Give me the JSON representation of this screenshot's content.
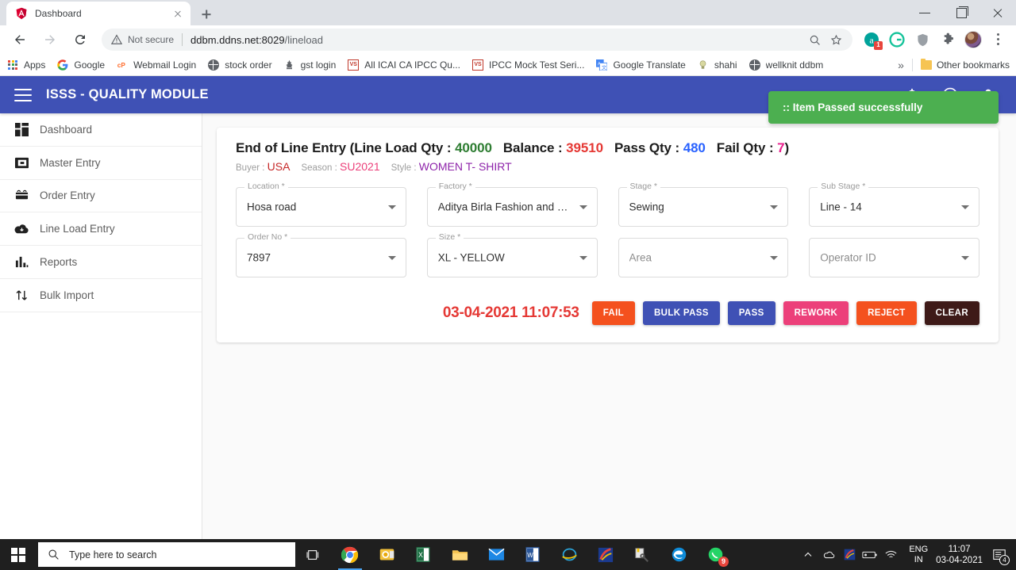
{
  "browser": {
    "tab": {
      "title": "Dashboard",
      "favicon": "angular-icon"
    },
    "newtab_label": "+",
    "omnibox": {
      "security_label": "Not secure",
      "url_host": "ddbm.ddns.net:8029",
      "url_path": "/lineload"
    },
    "bookmarks": [
      {
        "label": "Apps",
        "icon": "apps-grid-icon"
      },
      {
        "label": "Google",
        "icon": "google-icon"
      },
      {
        "label": "Webmail Login",
        "icon": "cpanel-icon"
      },
      {
        "label": "stock order",
        "icon": "globe-icon"
      },
      {
        "label": "gst login",
        "icon": "emblem-icon"
      },
      {
        "label": "All ICAI CA IPCC Qu...",
        "icon": "vs-icon"
      },
      {
        "label": "IPCC Mock Test Seri...",
        "icon": "vs-icon"
      },
      {
        "label": "Google Translate",
        "icon": "translate-icon"
      },
      {
        "label": "shahi",
        "icon": "bulb-icon"
      },
      {
        "label": "wellknit ddbm",
        "icon": "globe-icon"
      }
    ],
    "overflow_label": "»",
    "other_bookmarks_label": "Other bookmarks",
    "extension_badge": "1"
  },
  "app": {
    "title": "ISSS - QUALITY MODULE",
    "menu_icon": "hamburger-icon",
    "header_icons": [
      "notifications-icon",
      "help-icon",
      "account-icon"
    ],
    "toast": {
      "message": ":: Item Passed successfully",
      "color": "#4caf50"
    }
  },
  "sidebar": {
    "items": [
      {
        "label": "Dashboard",
        "icon": "dashboard-icon"
      },
      {
        "label": "Master Entry",
        "icon": "master-entry-icon"
      },
      {
        "label": "Order Entry",
        "icon": "order-entry-icon"
      },
      {
        "label": "Line Load Entry",
        "icon": "cloud-download-icon"
      },
      {
        "label": "Reports",
        "icon": "bar-chart-icon"
      },
      {
        "label": "Bulk Import",
        "icon": "import-export-icon"
      }
    ]
  },
  "main": {
    "headline": {
      "prefix": "End of Line Entry (Line Load Qty : ",
      "line_load_qty": "40000",
      "balance_label": "Balance : ",
      "balance": "39510",
      "pass_label": "Pass Qty : ",
      "pass_qty": "480",
      "fail_label": "Fail Qty : ",
      "fail_qty": "7",
      "suffix": ")"
    },
    "subline": {
      "buyer_label": "Buyer : ",
      "buyer": "USA",
      "season_label": "Season : ",
      "season": "SU2021",
      "style_label": "Style : ",
      "style": "WOMEN T- SHIRT"
    },
    "fields": [
      {
        "label": "Location *",
        "value": "Hosa road",
        "empty": false
      },
      {
        "label": "Factory *",
        "value": "Aditya Birla Fashion and Retail Li...",
        "empty": false
      },
      {
        "label": "Stage *",
        "value": "Sewing",
        "empty": false
      },
      {
        "label": "Sub Stage *",
        "value": "Line - 14",
        "empty": false
      },
      {
        "label": "Order No *",
        "value": "7897",
        "empty": false
      },
      {
        "label": "Size *",
        "value": "XL - YELLOW",
        "empty": false
      },
      {
        "label": "",
        "value": "Area",
        "empty": true
      },
      {
        "label": "",
        "value": "Operator ID",
        "empty": true
      }
    ],
    "timestamp": "03-04-2021 11:07:53",
    "buttons": [
      {
        "label": "FAIL",
        "color": "#f4511e"
      },
      {
        "label": "BULK PASS",
        "color": "#3f51b5"
      },
      {
        "label": "PASS",
        "color": "#3f51b5"
      },
      {
        "label": "REWORK",
        "color": "#ec407a"
      },
      {
        "label": "REJECT",
        "color": "#f4511e"
      },
      {
        "label": "CLEAR",
        "color": "#3e1a18"
      }
    ]
  },
  "taskbar": {
    "search_placeholder": "Type here to search",
    "apps": [
      "task-view-icon",
      "chrome-icon",
      "outlook-icon",
      "excel-icon",
      "file-explorer-icon",
      "mail-icon",
      "word-icon",
      "internet-explorer-icon",
      "paint-icon",
      "tools-icon",
      "edge-icon",
      "whatsapp-icon"
    ],
    "whatsapp_badge": "9",
    "language": "ENG",
    "region": "IN",
    "time": "11:07",
    "date": "03-04-2021",
    "notification_count": "4"
  }
}
